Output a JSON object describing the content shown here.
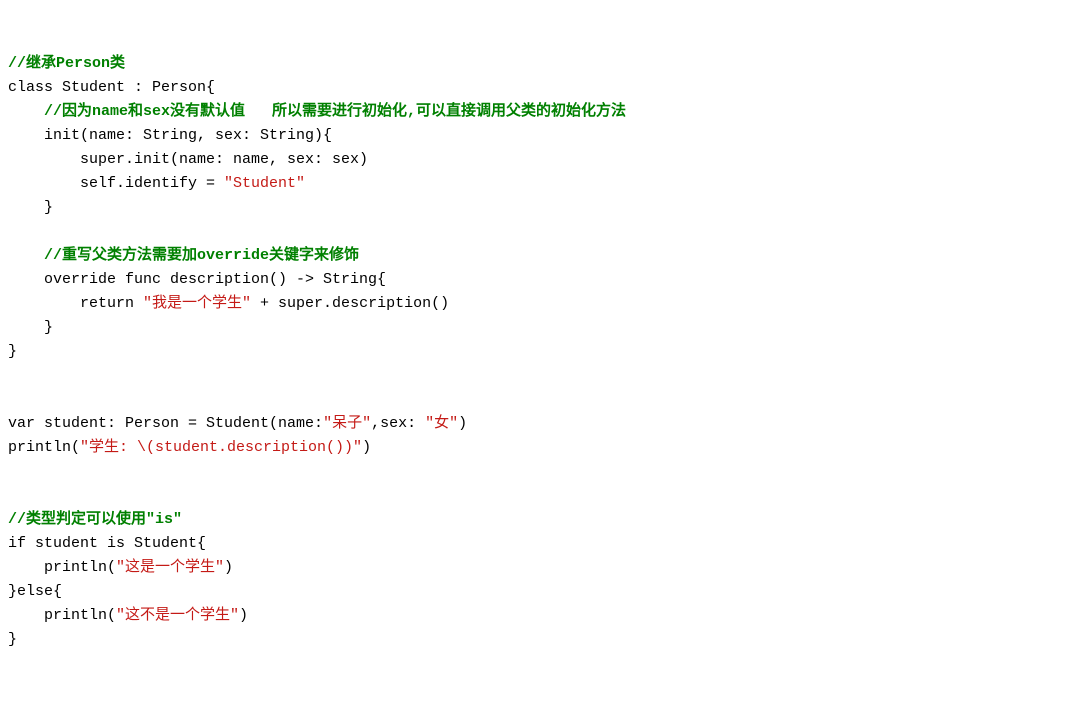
{
  "lines": {
    "l1_comment": "//继承Person类",
    "l2_class": "class Student : Person{",
    "l3_comment": "    //因为name和sex没有默认值   所以需要进行初始化,可以直接调用父类的初始化方法",
    "l4_init": "    init(name: String, sex: String){",
    "l5_super": "        super.init(name: name, sex: sex)",
    "l6_self_prefix": "        self.identify = ",
    "l6_string": "\"Student\"",
    "l7_brace": "    }",
    "l8_blank": "",
    "l9_comment": "    //重写父类方法需要加override关键字来修饰",
    "l10_override": "    override func description() -> String{",
    "l11_return_prefix": "        return ",
    "l11_string": "\"我是一个学生\"",
    "l11_suffix": " + super.description()",
    "l12_brace": "    }",
    "l13_brace": "}",
    "l14_blank": "",
    "l15_blank": "",
    "l16_var_prefix": "var student: Person = Student(name:",
    "l16_string1": "\"呆子\"",
    "l16_mid": ",sex: ",
    "l16_string2": "\"女\"",
    "l16_suffix": ")",
    "l17_println_prefix": "println(",
    "l17_string": "\"学生: \\(student.description())\"",
    "l17_suffix": ")",
    "l18_blank": "",
    "l19_blank": "",
    "l20_comment": "//类型判定可以使用\"is\"",
    "l21_if": "if student is Student{",
    "l22_println_prefix": "    println(",
    "l22_string": "\"这是一个学生\"",
    "l22_suffix": ")",
    "l23_else": "}else{",
    "l24_println_prefix": "    println(",
    "l24_string": "\"这不是一个学生\"",
    "l24_suffix": ")",
    "l25_brace": "}"
  }
}
